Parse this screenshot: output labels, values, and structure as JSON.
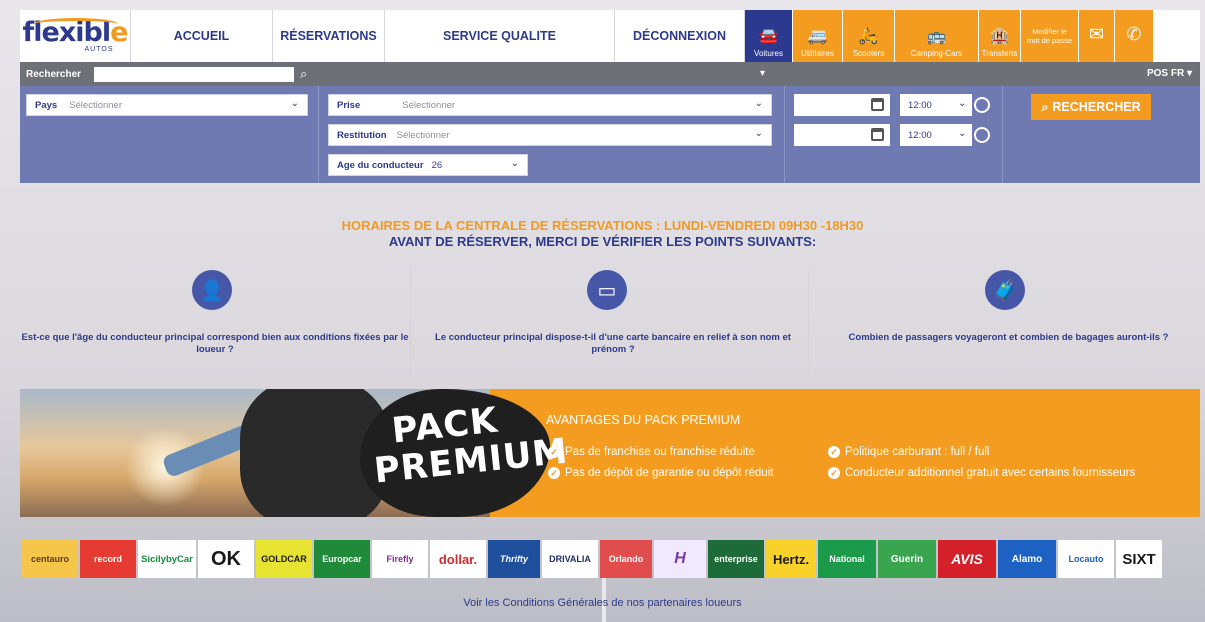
{
  "nav": {
    "logo_word_a": "flexibl",
    "logo_word_b": "e",
    "logo_sub": "AUTOS",
    "links": [
      "ACCUEIL",
      "RÉSERVATIONS",
      "SERVICE QUALITE",
      "DÉCONNEXION"
    ],
    "vehicles": [
      {
        "label": "Voitures",
        "icon": "car-icon"
      },
      {
        "label": "Utilitaires",
        "icon": "van-icon"
      },
      {
        "label": "Scooters",
        "icon": "scooter-icon"
      },
      {
        "label": "Camping-Cars",
        "icon": "camper-icon"
      },
      {
        "label": "Transferts",
        "icon": "transfer-icon"
      }
    ],
    "modify_password": "Modifier le mot de passe",
    "mail_icon": "mail-icon",
    "phone_icon": "phone-icon",
    "active_color": "#2b3a8f",
    "accent_color": "#f39c1f"
  },
  "search": {
    "label": "Rechercher",
    "value": "",
    "lang": "POS FR"
  },
  "form": {
    "country_label": "Pays",
    "country_value": "Sélectionner",
    "pickup_label": "Prise",
    "pickup_value": "Sélectionner",
    "return_label": "Restitution",
    "return_value": "Sélectionner",
    "age_label": "Age du conducteur",
    "age_value": "26",
    "pickup_time": "12:00",
    "return_time": "12:00",
    "search_button": "RECHERCHER"
  },
  "info": {
    "hours": "HORAIRES DE LA CENTRALE DE RÉSERVATIONS : LUNDI-VENDREDI 09H30 -18H30",
    "warning": "AVANT DE RÉSERVER, MERCI DE VÉRIFIER LES POINTS SUIVANTS:",
    "checks": [
      {
        "icon": "driver-icon",
        "text": "Est-ce que l'âge du conducteur principal correspond bien aux conditions fixées par le loueur ?"
      },
      {
        "icon": "credit-card-icon",
        "text": "Le conducteur principal dispose-t-il d'une carte bancaire en relief à son nom et prénom ?"
      },
      {
        "icon": "luggage-icon",
        "text": "Combien de passagers voyageront et combien de bagages auront-ils ?"
      }
    ]
  },
  "premium": {
    "pack_line1": "PACK",
    "pack_line2": "PREMIUM",
    "title": "AVANTAGES DU PACK PREMIUM",
    "advantages": [
      "Pas de franchise ou franchise réduite",
      "Pas de dépôt de garantie ou dépôt réduit",
      "Politique carburant : full / full",
      "Conducteur additionnel gratuit avec certains fournisseurs"
    ]
  },
  "partners": {
    "logos": [
      "centauro",
      "record",
      "SicilybyCar",
      "OK",
      "GOLDCAR",
      "Europcar",
      "Firefly",
      "dollar.",
      "Thrifty",
      "DRIVALIA",
      "Orlando",
      "H",
      "enterprise",
      "Hertz.",
      "National",
      "Guerin",
      "AVIS",
      "Alamo",
      "Locauto",
      "SIXT"
    ],
    "terms": "Voir les Conditions Générales de nos partenaires loueurs"
  }
}
